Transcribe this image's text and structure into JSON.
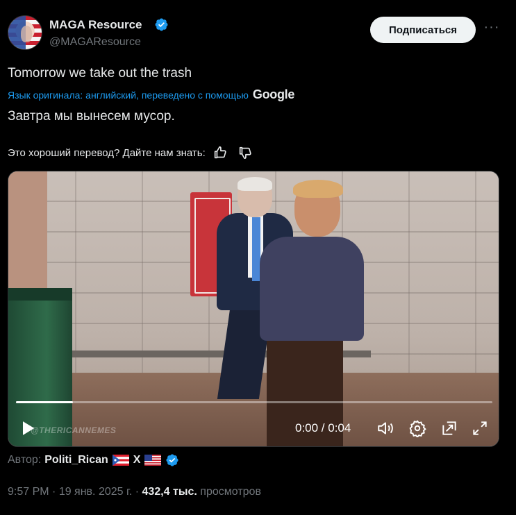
{
  "header": {
    "name": "MAGA Resource",
    "handle": "@MAGAResource",
    "subscribe_label": "Подписаться",
    "more_label": "···"
  },
  "tweet": {
    "text": "Tomorrow we take out the trash",
    "translation_note": "Язык оригинала: английский, переведено с помощью",
    "translation_provider": "Google",
    "translated_text": "Завтра мы вынесем мусор.",
    "feedback_prompt": "Это хороший перевод? Дайте нам знать:"
  },
  "video": {
    "watermark": "@THERICANNEMES",
    "time_display": "0:00 / 0:04",
    "progress_fraction": 0.12
  },
  "author": {
    "prefix": "Автор:",
    "name": "Politi_Rican",
    "x_mark": "X"
  },
  "meta": {
    "time": "9:57 PM",
    "separator1": " · ",
    "date": "19 янв. 2025 г.",
    "separator2": " · ",
    "views": "432,4 тыс.",
    "views_label": " просмотров"
  },
  "colors": {
    "accent": "#1d9bf0",
    "background": "#000000",
    "secondary_text": "#71767b"
  },
  "icons": [
    "verified-badge-icon",
    "more-icon",
    "thumbs-up-icon",
    "thumbs-down-icon",
    "play-icon",
    "volume-icon",
    "settings-icon",
    "pip-icon",
    "fullscreen-icon",
    "puerto-rico-flag-icon",
    "us-flag-icon"
  ]
}
